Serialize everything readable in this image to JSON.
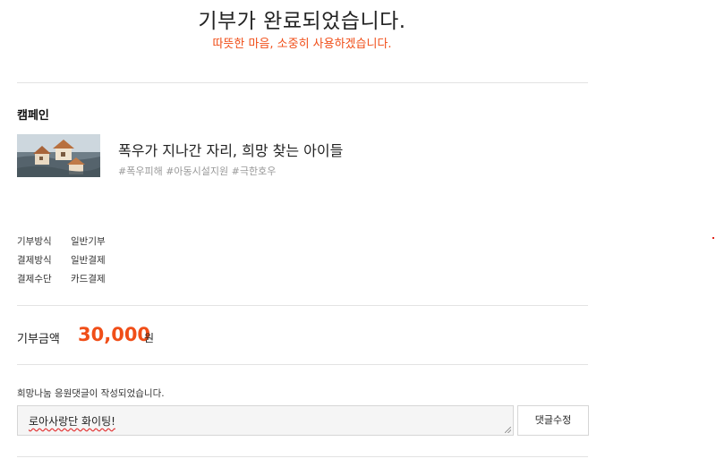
{
  "header": {
    "title": "기부가 완료되었습니다.",
    "subtitle": "따뜻한 마음, 소중히 사용하겠습니다."
  },
  "campaign": {
    "section_label": "캠페인",
    "title": "폭우가 지나간 자리, 희망 찾는 아이들",
    "tags": "#폭우피해 #아동시설지원 #극한호우"
  },
  "details": [
    {
      "label": "기부방식",
      "value": "일반기부"
    },
    {
      "label": "결제방식",
      "value": "일반결제"
    },
    {
      "label": "결제수단",
      "value": "카드결제"
    }
  ],
  "amount": {
    "label": "기부금액",
    "value": "30,000",
    "unit": "원"
  },
  "comment": {
    "notice": "희망나눔 응원댓글이 작성되었습니다.",
    "text": "로아사랑단 화이팅!",
    "edit_button": "댓글수정"
  },
  "colors": {
    "accent": "#f04e18",
    "divider": "#e3e3e3",
    "input_bg": "#f5f5f5"
  }
}
